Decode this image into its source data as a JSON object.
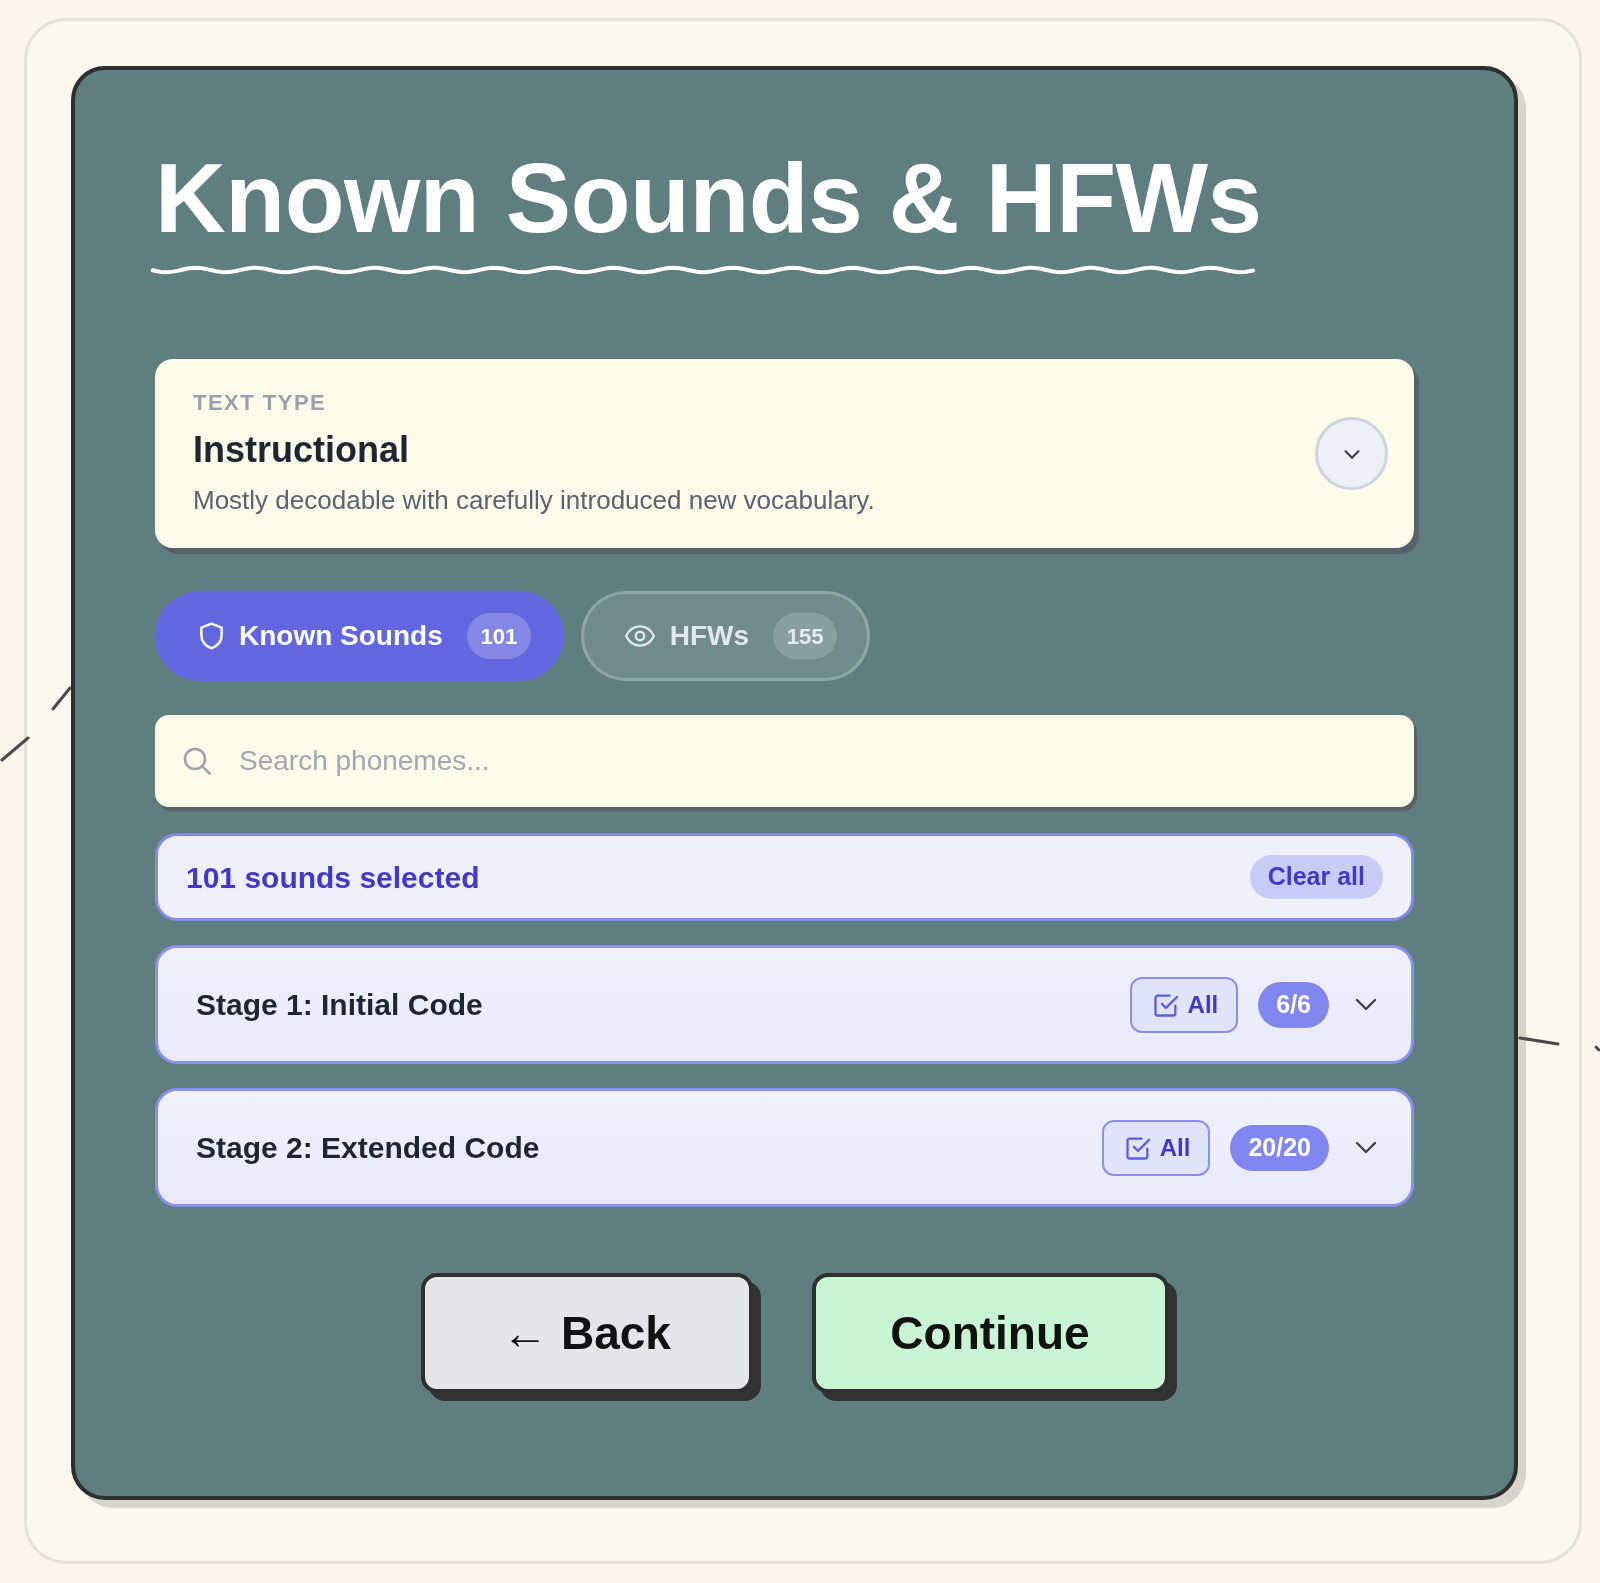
{
  "title": "Known Sounds & HFWs",
  "text_type": {
    "label": "TEXT TYPE",
    "value": "Instructional",
    "description": "Mostly decodable with carefully introduced new vocabulary.",
    "expanded": false
  },
  "tabs": [
    {
      "label": "Known Sounds",
      "count": "101",
      "selected": true
    },
    {
      "label": "HFWs",
      "count": "155",
      "selected": false
    }
  ],
  "search": {
    "placeholder": "Search phonemes..."
  },
  "selection": {
    "summary": "101 sounds selected",
    "clear_label": "Clear all"
  },
  "stages": [
    {
      "title": "Stage 1: Initial Code",
      "all_label": "All",
      "count": "6/6",
      "expanded": false
    },
    {
      "title": "Stage 2: Extended Code",
      "all_label": "All",
      "count": "20/20",
      "expanded": false
    }
  ],
  "buttons": [
    {
      "label": "← Back",
      "kind": "secondary"
    },
    {
      "label": "Continue",
      "kind": "primary"
    }
  ]
}
